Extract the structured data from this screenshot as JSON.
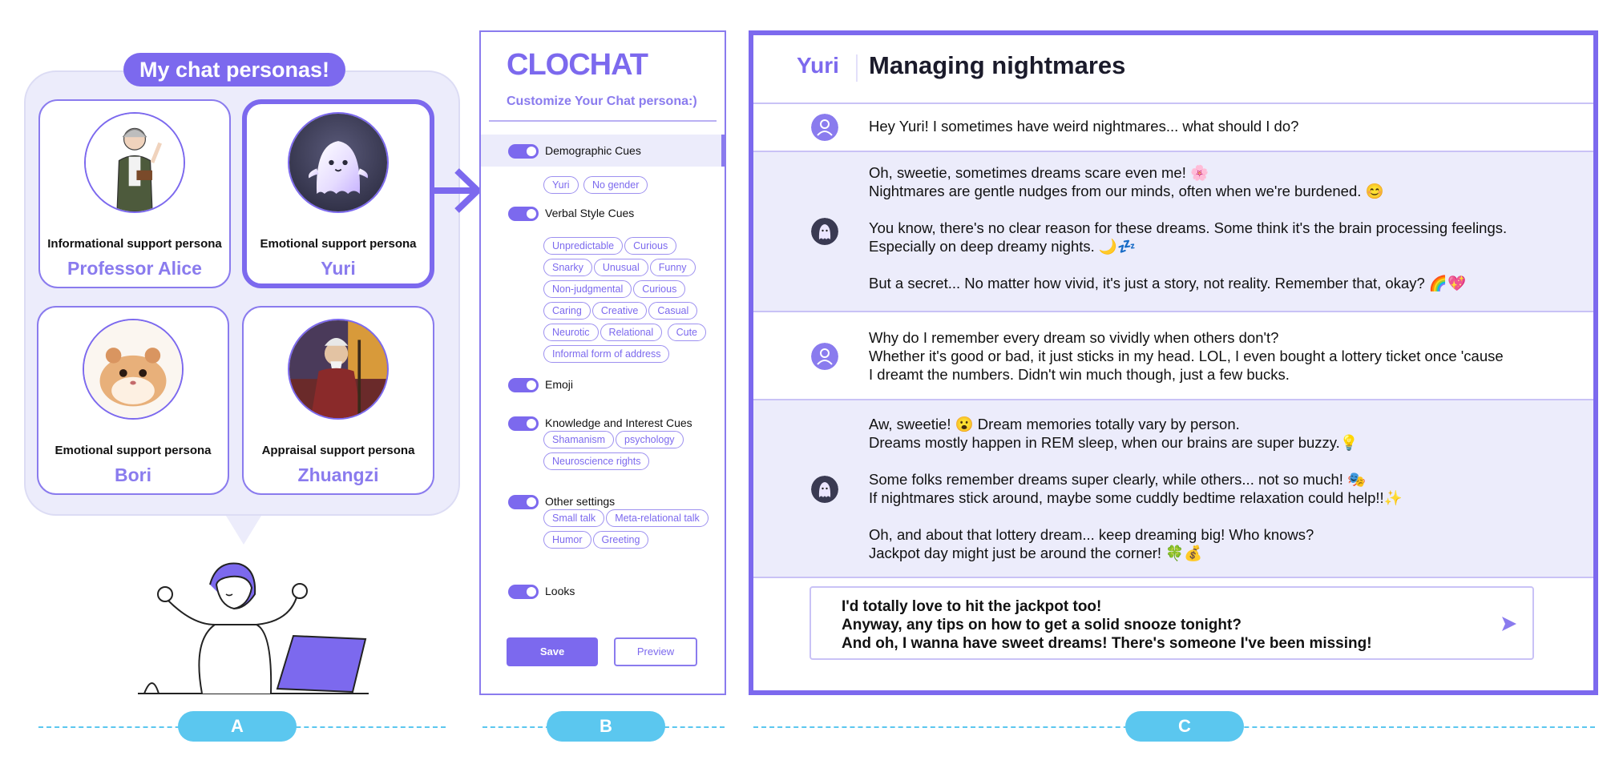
{
  "panel_a": {
    "title": "My chat personas!",
    "personas": [
      {
        "type": "Informational support persona",
        "name": "Professor Alice",
        "selected": false
      },
      {
        "type": "Emotional support persona",
        "name": "Yuri",
        "selected": true
      },
      {
        "type": "Emotional support persona",
        "name": "Bori",
        "selected": false
      },
      {
        "type": "Appraisal support persona",
        "name": "Zhuangzi",
        "selected": false
      }
    ]
  },
  "panel_b": {
    "brand": "CLOCHAT",
    "subtitle": "Customize Your Chat persona:)",
    "settings": [
      {
        "label": "Demographic Cues",
        "enabled": true,
        "chips": [
          "Yuri",
          "No gender"
        ]
      },
      {
        "label": "Verbal Style Cues",
        "enabled": true,
        "chips": [
          "Unpredictable",
          "Curious",
          "Snarky",
          "Unusual",
          "Funny",
          "Non-judgmental",
          "Curious",
          "Caring",
          "Creative",
          "Casual",
          "Neurotic",
          "Relational",
          "Cute",
          "Informal form of address"
        ]
      },
      {
        "label": "Emoji",
        "enabled": true,
        "chips": []
      },
      {
        "label": "Knowledge and Interest Cues",
        "enabled": true,
        "chips": [
          "Shamanism",
          "psychology",
          "Neuroscience rights"
        ]
      },
      {
        "label": "Other settings",
        "enabled": true,
        "chips": [
          "Small talk",
          "Meta-relational talk",
          "Humor",
          "Greeting"
        ]
      },
      {
        "label": "Looks",
        "enabled": true,
        "chips": []
      }
    ],
    "save_label": "Save",
    "preview_label": "Preview"
  },
  "panel_c": {
    "persona_name": "Yuri",
    "chat_title": "Managing nightmares",
    "messages": [
      {
        "role": "user",
        "paragraphs": [
          [
            "Hey Yuri! I sometimes have weird nightmares... what should I do?"
          ]
        ]
      },
      {
        "role": "bot",
        "paragraphs": [
          [
            "Oh, sweetie, sometimes dreams scare even me! 🌸",
            "Nightmares are gentle nudges from our minds, often when we're burdened. 😊"
          ],
          [
            "You know, there's no clear reason for these dreams. Some think it's the brain processing feelings.",
            "Especially on deep dreamy nights. 🌙💤"
          ],
          [
            "But a secret... No matter how vivid, it's just a story, not reality. Remember that, okay? 🌈💖"
          ]
        ]
      },
      {
        "role": "user",
        "paragraphs": [
          [
            "Why do I remember every dream so vividly when others don't?",
            "Whether it's good or bad, it just sticks in my head. LOL, I even bought a lottery ticket once 'cause",
            "I dreamt the numbers. Didn't win much though, just a few bucks."
          ]
        ]
      },
      {
        "role": "bot",
        "paragraphs": [
          [
            "Aw, sweetie! 😮 Dream memories totally vary by person.",
            "Dreams mostly happen in REM sleep, when our brains are super buzzy.💡"
          ],
          [
            "Some folks remember dreams super clearly, while others... not so much! 🎭",
            "If nightmares stick around, maybe some cuddly bedtime relaxation could help!!✨"
          ],
          [
            "Oh, and about that lottery dream... keep dreaming big! Who knows?",
            "Jackpot day might just be around the corner! 🍀💰"
          ]
        ]
      }
    ],
    "input_lines": [
      "I'd totally love to hit the jackpot too!",
      "Anyway, any tips on how to get a solid snooze tonight?",
      "And oh, I wanna have sweet dreams! There's someone I've been missing!"
    ]
  },
  "section_labels": [
    "A",
    "B",
    "C"
  ],
  "colors": {
    "accent": "#7c69ee",
    "accent_light": "#ececfb",
    "label_blue": "#5bc7ef"
  }
}
